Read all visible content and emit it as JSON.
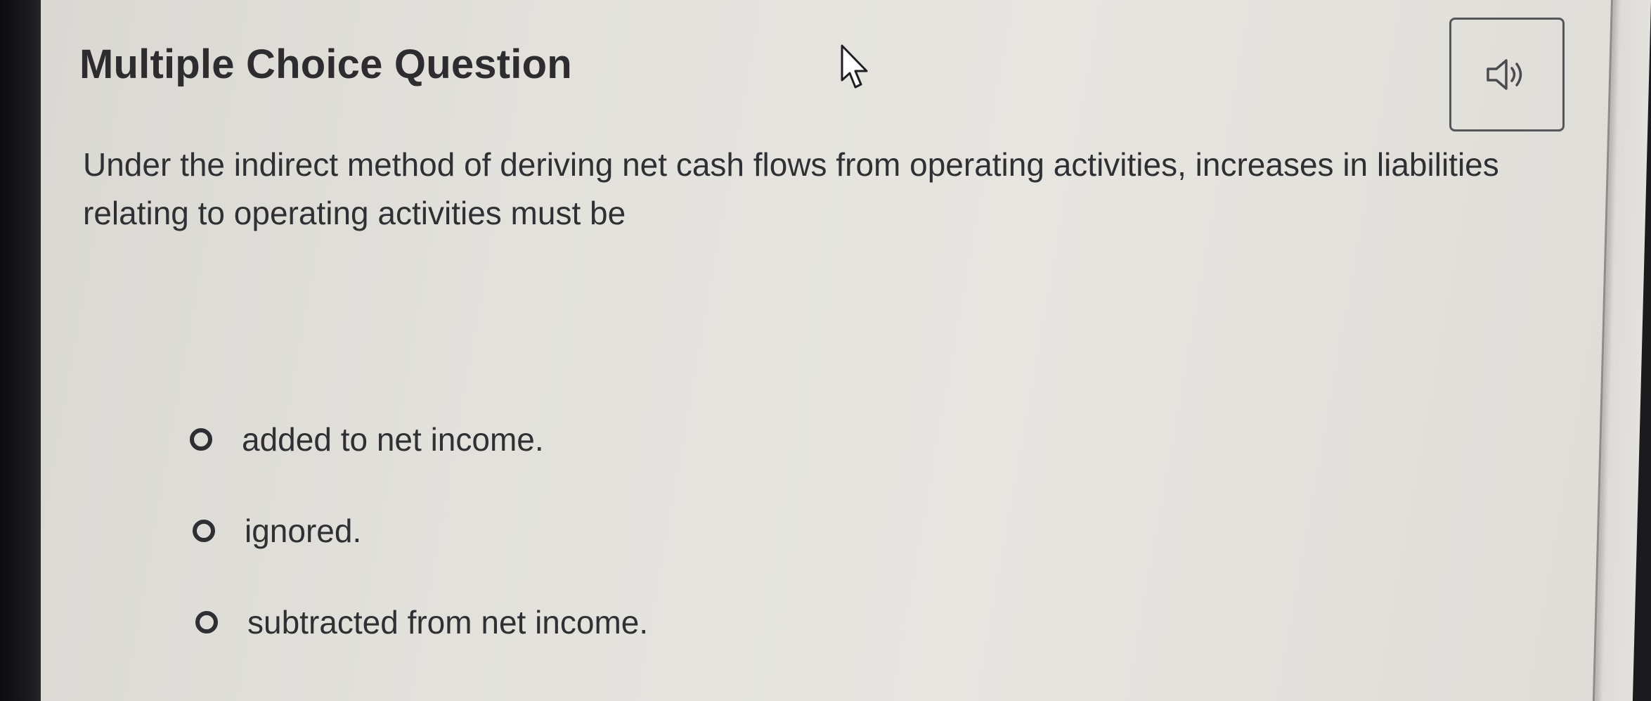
{
  "header": {
    "title": "Multiple Choice Question",
    "audio_icon": "speaker-volume-icon"
  },
  "question": {
    "text": "Under the indirect method of deriving net cash flows from operating activities, increases in liabilities relating to operating activities must be"
  },
  "choices": [
    {
      "label": "added to net income."
    },
    {
      "label": "ignored."
    },
    {
      "label": "subtracted from net income."
    }
  ],
  "colors": {
    "text": "#2f3033",
    "screen_background": "#e3e2dd",
    "border": "#55565a"
  }
}
